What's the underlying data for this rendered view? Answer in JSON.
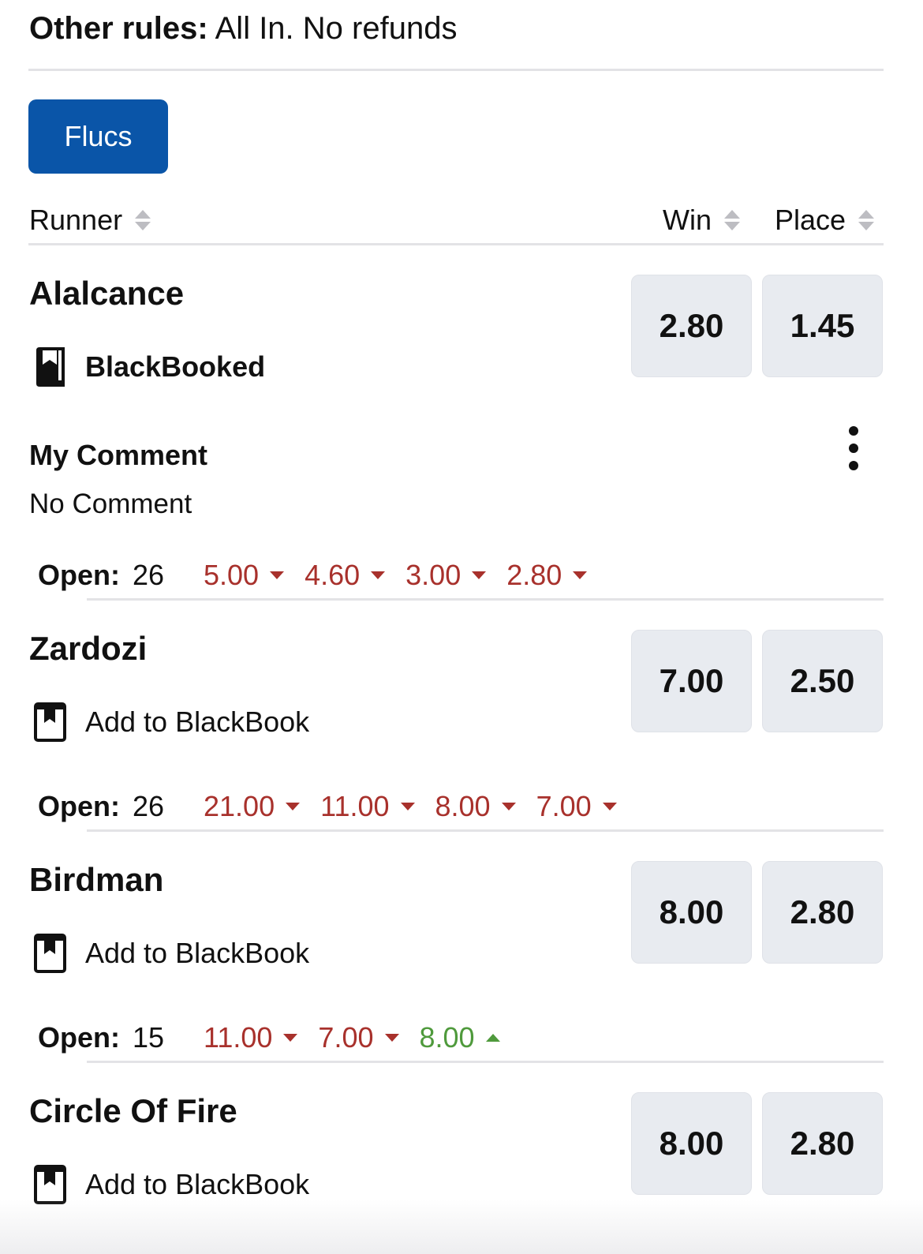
{
  "rules": {
    "label": "Other rules:",
    "text": "All In. No refunds"
  },
  "flucs_button": "Flucs",
  "table_header": {
    "runner": "Runner",
    "win": "Win",
    "place": "Place"
  },
  "runners": [
    {
      "name": "Alalcance",
      "blackbook_label": "BlackBooked",
      "blackbooked": true,
      "win": "2.80",
      "place": "1.45",
      "comment_title": "My Comment",
      "comment_text": "No Comment",
      "open_label": "Open:",
      "open_value": "26",
      "flucs": [
        {
          "value": "5.00",
          "direction": "down"
        },
        {
          "value": "4.60",
          "direction": "down"
        },
        {
          "value": "3.00",
          "direction": "down"
        },
        {
          "value": "2.80",
          "direction": "down"
        }
      ]
    },
    {
      "name": "Zardozi",
      "blackbook_label": "Add to BlackBook",
      "blackbooked": false,
      "win": "7.00",
      "place": "2.50",
      "open_label": "Open:",
      "open_value": "26",
      "flucs": [
        {
          "value": "21.00",
          "direction": "down"
        },
        {
          "value": "11.00",
          "direction": "down"
        },
        {
          "value": "8.00",
          "direction": "down"
        },
        {
          "value": "7.00",
          "direction": "down"
        }
      ]
    },
    {
      "name": "Birdman",
      "blackbook_label": "Add to BlackBook",
      "blackbooked": false,
      "win": "8.00",
      "place": "2.80",
      "open_label": "Open:",
      "open_value": "15",
      "flucs": [
        {
          "value": "11.00",
          "direction": "down"
        },
        {
          "value": "7.00",
          "direction": "down"
        },
        {
          "value": "8.00",
          "direction": "up"
        }
      ]
    },
    {
      "name": "Circle Of Fire",
      "blackbook_label": "Add to BlackBook",
      "blackbooked": false,
      "win": "8.00",
      "place": "2.80"
    }
  ],
  "colors": {
    "button_blue": "#0a55a8",
    "fluc_down": "#a8312c",
    "fluc_up": "#4f9a3c",
    "odds_bg": "#e8ebf0"
  },
  "icons": {
    "blackbooked": "book-filled-icon",
    "add_blackbook": "book-outline-icon",
    "more": "more-vertical-icon"
  }
}
